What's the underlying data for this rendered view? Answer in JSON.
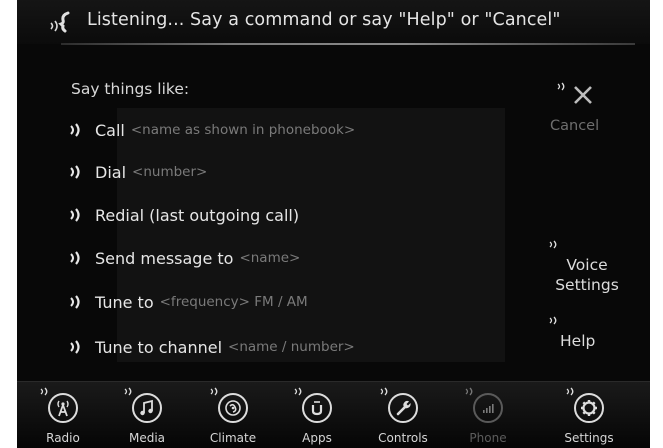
{
  "header": {
    "status_text": "Listening... Say a command or say \"Help\" or \"Cancel\"",
    "icon": "voice-recognition-icon"
  },
  "main": {
    "title": "Say things like:",
    "commands": [
      {
        "main": "Call",
        "hint": "<name as shown in phonebook>"
      },
      {
        "main": "Dial",
        "hint": "<number>"
      },
      {
        "main": "Redial (last outgoing call)",
        "hint": ""
      },
      {
        "main": "Send message to",
        "hint": "<name>"
      },
      {
        "main": "Tune to",
        "hint": "<frequency> FM / AM"
      },
      {
        "main": "Tune to channel",
        "hint": "<name / number>"
      }
    ]
  },
  "side": {
    "cancel_label": "Cancel",
    "voice_settings_line1": "Voice",
    "voice_settings_line2": "Settings",
    "help_label": "Help"
  },
  "dock": {
    "items": [
      {
        "label": "Radio",
        "icon": "radio-icon"
      },
      {
        "label": "Media",
        "icon": "media-icon"
      },
      {
        "label": "Climate",
        "icon": "climate-icon"
      },
      {
        "label": "Apps",
        "icon": "apps-icon"
      },
      {
        "label": "Controls",
        "icon": "controls-icon"
      },
      {
        "label": "Phone",
        "icon": "phone-icon",
        "disabled": true
      },
      {
        "label": "Settings",
        "icon": "settings-icon"
      }
    ]
  },
  "colors": {
    "background": "#080808",
    "text": "#e6e6e6",
    "hint": "#7a7a7a",
    "disabled": "#5c5c5c"
  }
}
